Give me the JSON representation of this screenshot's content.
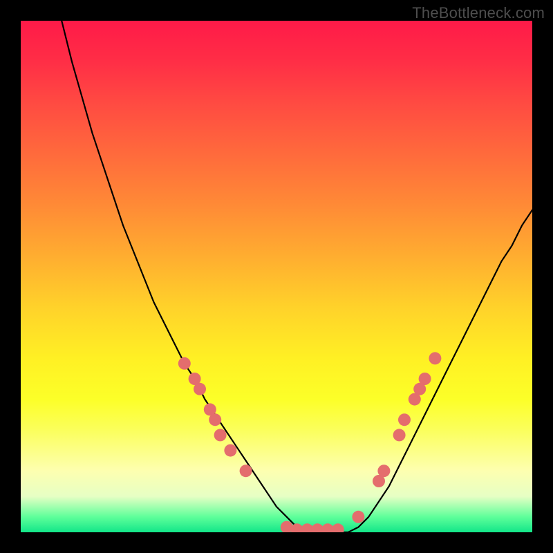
{
  "watermark": "TheBottleneck.com",
  "colors": {
    "curve_stroke": "#000000",
    "dot_fill": "#e46d6d",
    "dot_stroke": "#e46d6d",
    "bg_frame": "#000000"
  },
  "chart_data": {
    "type": "line",
    "title": "",
    "xlabel": "",
    "ylabel": "",
    "xlim": [
      0,
      100
    ],
    "ylim": [
      0,
      100
    ],
    "series": [
      {
        "name": "bottleneck-curve",
        "x": [
          8,
          10,
          12,
          14,
          16,
          18,
          20,
          22,
          24,
          26,
          28,
          30,
          32,
          34,
          36,
          38,
          40,
          42,
          44,
          46,
          48,
          50,
          52,
          54,
          56,
          58,
          60,
          62,
          64,
          66,
          68,
          70,
          72,
          74,
          76,
          78,
          80,
          82,
          84,
          86,
          88,
          90,
          92,
          94,
          96,
          98,
          100
        ],
        "y": [
          100,
          92,
          85,
          78,
          72,
          66,
          60,
          55,
          50,
          45,
          41,
          37,
          33,
          30,
          26,
          23,
          20,
          17,
          14,
          11,
          8,
          5,
          3,
          1,
          0,
          0,
          0,
          0,
          0,
          1,
          3,
          6,
          9,
          13,
          17,
          21,
          25,
          29,
          33,
          37,
          41,
          45,
          49,
          53,
          56,
          60,
          63
        ]
      }
    ],
    "markers": [
      {
        "x": 32,
        "y": 33
      },
      {
        "x": 34,
        "y": 30
      },
      {
        "x": 35,
        "y": 28
      },
      {
        "x": 37,
        "y": 24
      },
      {
        "x": 38,
        "y": 22
      },
      {
        "x": 39,
        "y": 19
      },
      {
        "x": 41,
        "y": 16
      },
      {
        "x": 44,
        "y": 12
      },
      {
        "x": 52,
        "y": 1
      },
      {
        "x": 54,
        "y": 0.5
      },
      {
        "x": 56,
        "y": 0.5
      },
      {
        "x": 58,
        "y": 0.5
      },
      {
        "x": 60,
        "y": 0.5
      },
      {
        "x": 62,
        "y": 0.5
      },
      {
        "x": 66,
        "y": 3
      },
      {
        "x": 70,
        "y": 10
      },
      {
        "x": 71,
        "y": 12
      },
      {
        "x": 74,
        "y": 19
      },
      {
        "x": 75,
        "y": 22
      },
      {
        "x": 77,
        "y": 26
      },
      {
        "x": 78,
        "y": 28
      },
      {
        "x": 79,
        "y": 30
      },
      {
        "x": 81,
        "y": 34
      }
    ],
    "grid": false,
    "legend": false
  }
}
